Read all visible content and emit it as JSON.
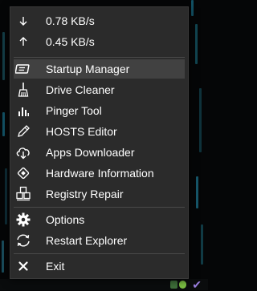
{
  "network": {
    "download": {
      "icon": "arrow-down-icon",
      "value": "0.78 KB/s"
    },
    "upload": {
      "icon": "arrow-up-icon",
      "value": "0.45 KB/s"
    }
  },
  "menu": {
    "items": [
      {
        "label": "Startup Manager",
        "icon": "startup-manager-icon",
        "highlighted": true
      },
      {
        "label": "Drive Cleaner",
        "icon": "broom-icon"
      },
      {
        "label": "Pinger Tool",
        "icon": "signal-bars-icon"
      },
      {
        "label": "HOSTS Editor",
        "icon": "pencil-icon"
      },
      {
        "label": "Apps Downloader",
        "icon": "cloud-download-icon"
      },
      {
        "label": "Hardware Information",
        "icon": "hardware-chip-icon"
      },
      {
        "label": "Registry Repair",
        "icon": "registry-cubes-icon"
      },
      {
        "label": "Options",
        "icon": "gear-icon"
      },
      {
        "label": "Restart Explorer",
        "icon": "refresh-icon"
      },
      {
        "label": "Exit",
        "icon": "close-icon"
      }
    ]
  },
  "colors": {
    "menu_background": "#2b2b2b",
    "highlight": "#414141",
    "text": "#ffffff",
    "tray_check": "#9b7fe0"
  }
}
